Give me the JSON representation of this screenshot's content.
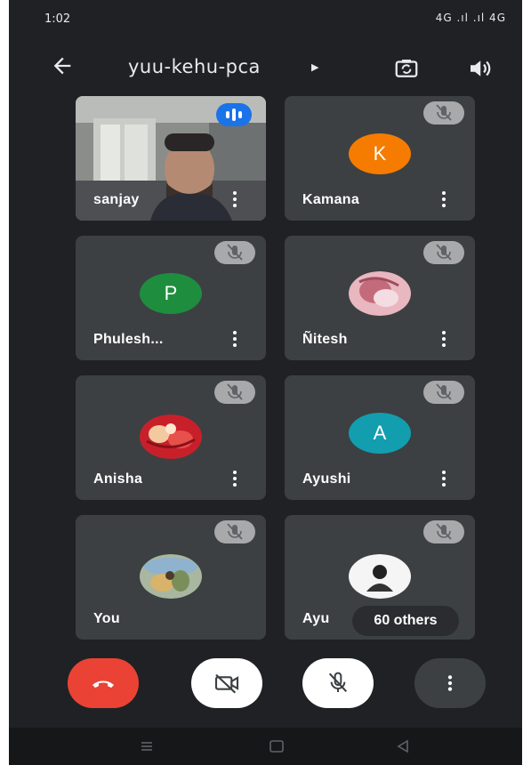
{
  "status_bar": {
    "time": "1:02",
    "indicators": "4G .ıl .ıl 4G"
  },
  "header": {
    "meeting_code": "yuu-kehu-pca"
  },
  "participants": [
    {
      "name": "sanjay",
      "type": "video",
      "speaking": true
    },
    {
      "name": "Kamana",
      "avatar_letter": "K",
      "avatar_color": "#f57c00",
      "muted": true
    },
    {
      "name": "Phulesh...",
      "avatar_letter": "P",
      "avatar_color": "#1e8e3e",
      "muted": true
    },
    {
      "name": "Ñitesh",
      "avatar_type": "photo",
      "muted": true
    },
    {
      "name": "Anisha",
      "avatar_type": "photo",
      "muted": true
    },
    {
      "name": "Ayushi",
      "avatar_letter": "A",
      "avatar_color": "#129eaf",
      "muted": true
    },
    {
      "name": "You",
      "avatar_type": "photo",
      "muted": true
    },
    {
      "name": "Ayu",
      "avatar_type": "photo",
      "muted": true
    }
  ],
  "others_pill": "60 others",
  "controls": {
    "end_call": "end-call-icon",
    "camera": "camera-off-icon",
    "microphone": "mic-off-icon",
    "more": "more-vert-icon"
  },
  "colors": {
    "background": "#202124",
    "tile": "#3c4043",
    "end_call": "#ea4335",
    "speaking": "#1a73e8"
  }
}
